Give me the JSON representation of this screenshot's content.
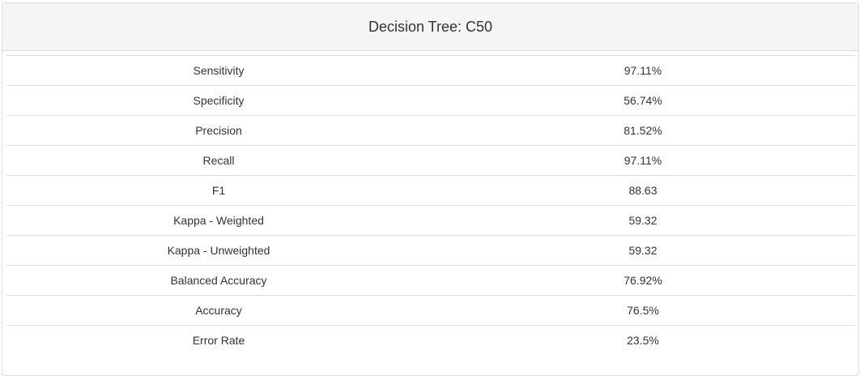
{
  "panel": {
    "title": "Decision Tree: C50"
  },
  "metrics": {
    "rows": [
      {
        "label": "Sensitivity",
        "value": "97.11%"
      },
      {
        "label": "Specificity",
        "value": "56.74%"
      },
      {
        "label": "Precision",
        "value": "81.52%"
      },
      {
        "label": "Recall",
        "value": "97.11%"
      },
      {
        "label": "F1",
        "value": "88.63"
      },
      {
        "label": "Kappa - Weighted",
        "value": "59.32"
      },
      {
        "label": "Kappa - Unweighted",
        "value": "59.32"
      },
      {
        "label": "Balanced Accuracy",
        "value": "76.92%"
      },
      {
        "label": "Accuracy",
        "value": "76.5%"
      },
      {
        "label": "Error Rate",
        "value": "23.5%"
      }
    ]
  }
}
